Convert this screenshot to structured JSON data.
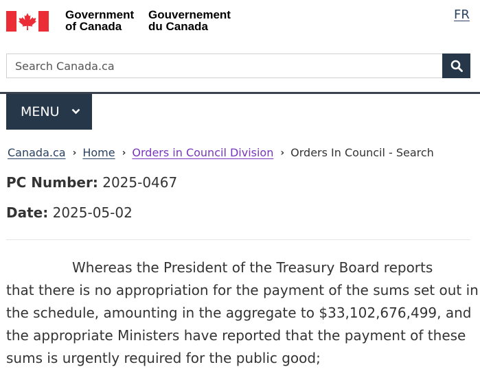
{
  "header": {
    "wordmark_en": "Government\nof Canada",
    "wordmark_fr": "Gouvernement\ndu Canada",
    "language_toggle": "FR",
    "search_placeholder": "Search Canada.ca"
  },
  "menu": {
    "label": "MENU"
  },
  "breadcrumb": [
    {
      "label": "Canada.ca"
    },
    {
      "label": "Home"
    },
    {
      "label": "Orders in Council Division"
    },
    {
      "label": "Orders In Council - Search"
    }
  ],
  "record": {
    "pc_label": "PC Number:",
    "pc_value": "2025-0467",
    "date_label": "Date:",
    "date_value": "2025-05-02"
  },
  "content": {
    "lines": [
      "Whereas the President of the Treasury Board reports",
      "that there is no appropriation for the payment of the sums set out in",
      "the schedule, amounting in the aggregate to $33,102,676,499, and",
      "the appropriate Ministers have reported that the payment of these",
      "sums is urgently required for the public good;"
    ]
  },
  "colors": {
    "flag_red": "#eb2d37",
    "nav_dark": "#26374a",
    "link": "#284162",
    "visited_link": "#7834bc"
  }
}
